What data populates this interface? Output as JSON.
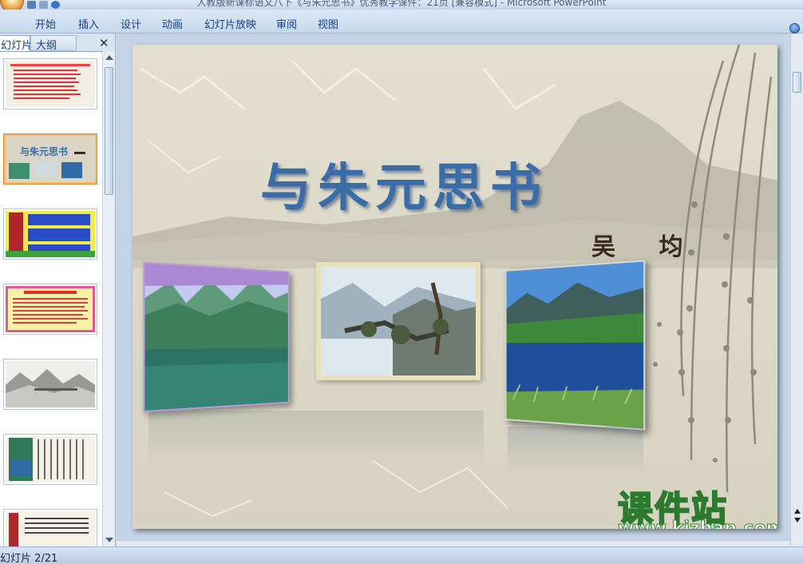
{
  "window": {
    "title": "人教版新课标语文八下《与朱元思书》优秀教学课件：21页 [兼容模式] - Microsoft PowerPoint"
  },
  "ribbon": {
    "tabs": [
      {
        "label": "开始"
      },
      {
        "label": "插入"
      },
      {
        "label": "设计"
      },
      {
        "label": "动画"
      },
      {
        "label": "幻灯片放映"
      },
      {
        "label": "审阅"
      },
      {
        "label": "视图"
      }
    ]
  },
  "left_panel": {
    "tab_slides": "幻灯片",
    "tab_outline": "大纲",
    "close_label": "✕",
    "selected_slide": 2
  },
  "slide": {
    "title": "与朱元思书",
    "author": "吴 均"
  },
  "watermark": {
    "name": "课件站",
    "url": "www.kjzhan.com"
  },
  "statusbar": {
    "slide_info": "幻灯片 2/21"
  },
  "colors": {
    "title_blue": "#3a6da8",
    "slide_bg": "#dad7c9",
    "ribbon_text": "#15428b",
    "selected_thumb": "#f5b86b"
  }
}
